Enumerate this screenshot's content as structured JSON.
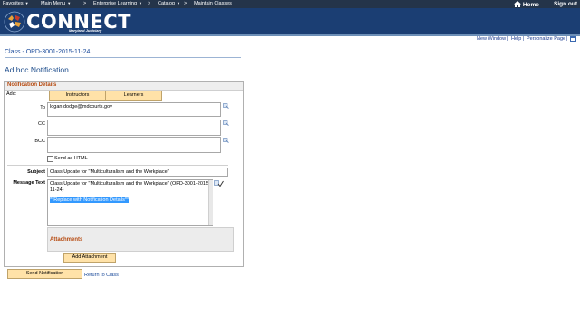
{
  "topnav": {
    "favorites": "Favorites",
    "main_menu": "Main Menu",
    "sep1": ">",
    "enterprise_learning": "Enterprise Learning",
    "sep2": ">",
    "catalog": "Catalog",
    "sep3": ">",
    "maintain_classes": "Maintain Classes",
    "home": "Home",
    "signout": "Sign out"
  },
  "brand": {
    "name": "CONNECT",
    "subtitle": "Maryland Judiciary"
  },
  "utility": {
    "new_window": "New Window",
    "sep1": "|",
    "help": "Help",
    "sep2": "|",
    "personalize": "Personalize Page",
    "sep3": "|"
  },
  "breadcrumb": "Class - OPD-3001-2015-11-24",
  "page_title": "Ad hoc Notification",
  "section": {
    "title": "Notification Details",
    "add_label": "Add:",
    "instructors_btn": "Instructors",
    "learners_btn": "Learners",
    "to_label": "To",
    "to_value": "logan.dodge@mdcourts.gov",
    "cc_label": "CC",
    "cc_value": "",
    "bcc_label": "BCC",
    "bcc_value": "",
    "html_label": "Send as HTML",
    "subject_label": "Subject",
    "subject_value": "Class Update for \"Multiculturalism and the Workplace\"",
    "message_label": "Message Text",
    "message_line1": "Class Update for \"Multiculturalism and the Workplace\" (OPD-3001-2015-",
    "message_line2": "11-24)",
    "message_placeholder": "**Replace with Notification Details**",
    "attachments_title": "Attachments",
    "add_attachment_btn": "Add Attachment"
  },
  "footer": {
    "send_btn": "Send Notification",
    "return_link": "Return to Class"
  },
  "colors": {
    "topbar": "#24344a",
    "brand_bar": "#1b3e73",
    "section_title": "#b64a10",
    "link": "#1a4a9a",
    "button": "#ffe2a8"
  }
}
